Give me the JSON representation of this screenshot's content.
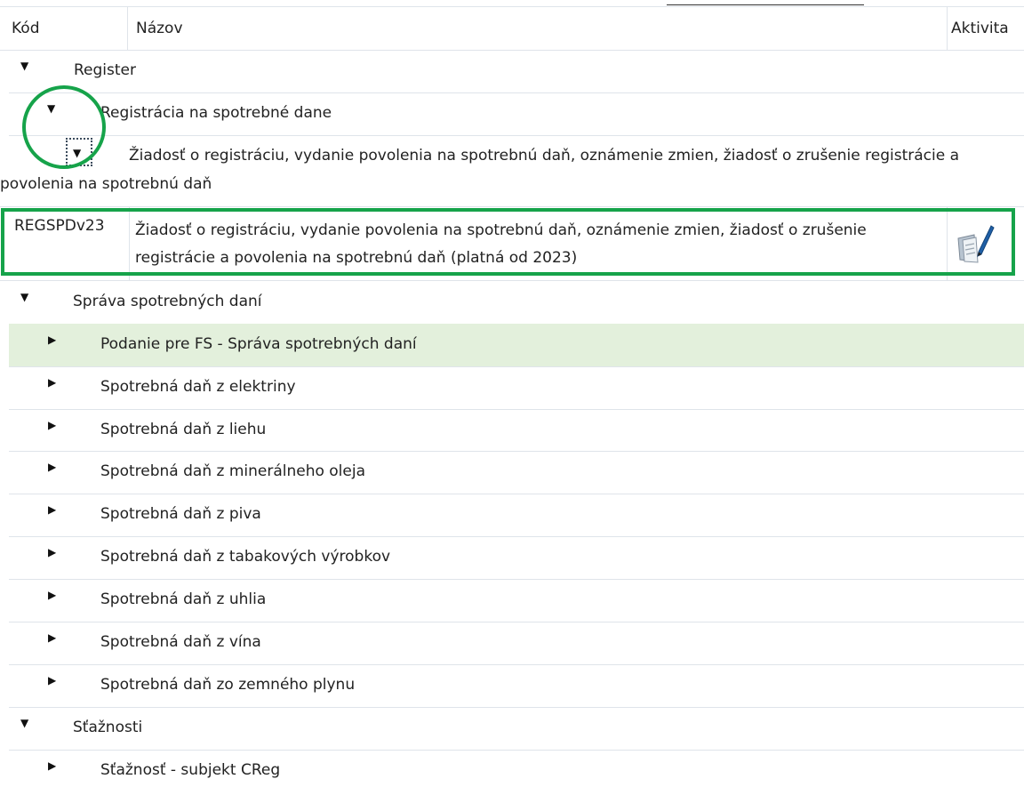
{
  "header": {
    "code": "Kód",
    "name": "Názov",
    "activity": "Aktivita"
  },
  "tree": {
    "register": "Register",
    "registracia": "Registrácia na spotrebné dane",
    "ziadost_group": "Žiadosť o registráciu, vydanie povolenia na spotrebnú daň, oznámenie zmien, žiadosť o zrušenie registrácie a povolenia na spotrebnú daň",
    "document": {
      "code": "REGSPDv23",
      "name": "Žiadosť o registráciu, vydanie povolenia na spotrebnú daň, oznámenie zmien, žiadosť o zrušenie registrácie a povolenia na spotrebnú daň (platná od 2023)"
    },
    "sprava": "Správa spotrebných daní",
    "sprava_items": [
      "Podanie pre FS - Správa spotrebných daní",
      "Spotrebná daň z elektriny",
      "Spotrebná daň z liehu",
      "Spotrebná daň z minerálneho oleja",
      "Spotrebná daň z piva",
      "Spotrebná daň z tabakových výrobkov",
      "Spotrebná daň z uhlia",
      "Spotrebná daň z vína",
      "Spotrebná daň zo zemného plynu"
    ],
    "staznosti": "Sťažnosti",
    "staznosti_items": [
      "Sťažnosť - subjekt CReg"
    ]
  },
  "colors": {
    "annotation": "#16a34a",
    "highlight_row": "#e3f0dc"
  }
}
